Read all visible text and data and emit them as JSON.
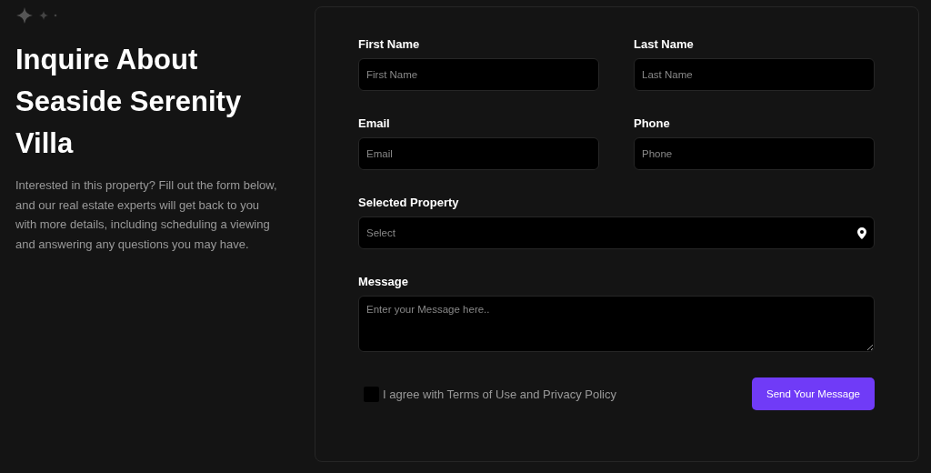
{
  "intro": {
    "title": "Inquire About Seaside Serenity Villa",
    "description": "Interested in this property? Fill out the form below, and our real estate experts will get back to you with more details, including scheduling a viewing and answering any questions you may have."
  },
  "form": {
    "rows": [
      {
        "fields": [
          {
            "label": "First Name",
            "placeholder": "First Name",
            "kind": "text"
          },
          {
            "label": "Last Name",
            "placeholder": "Last Name",
            "kind": "text"
          }
        ]
      },
      {
        "fields": [
          {
            "label": "Email",
            "placeholder": "Email",
            "kind": "text"
          },
          {
            "label": "Phone",
            "placeholder": "Phone",
            "kind": "text"
          }
        ]
      },
      {
        "fields": [
          {
            "label": "Selected Property",
            "placeholder": "Select",
            "kind": "select"
          }
        ]
      },
      {
        "fields": [
          {
            "label": "Message",
            "placeholder": "Enter your Message here..",
            "kind": "textarea"
          }
        ]
      }
    ],
    "agreement": {
      "label": "I agree with Terms of Use and Privacy Policy",
      "checked": false
    },
    "submit": "Send Your Message"
  }
}
